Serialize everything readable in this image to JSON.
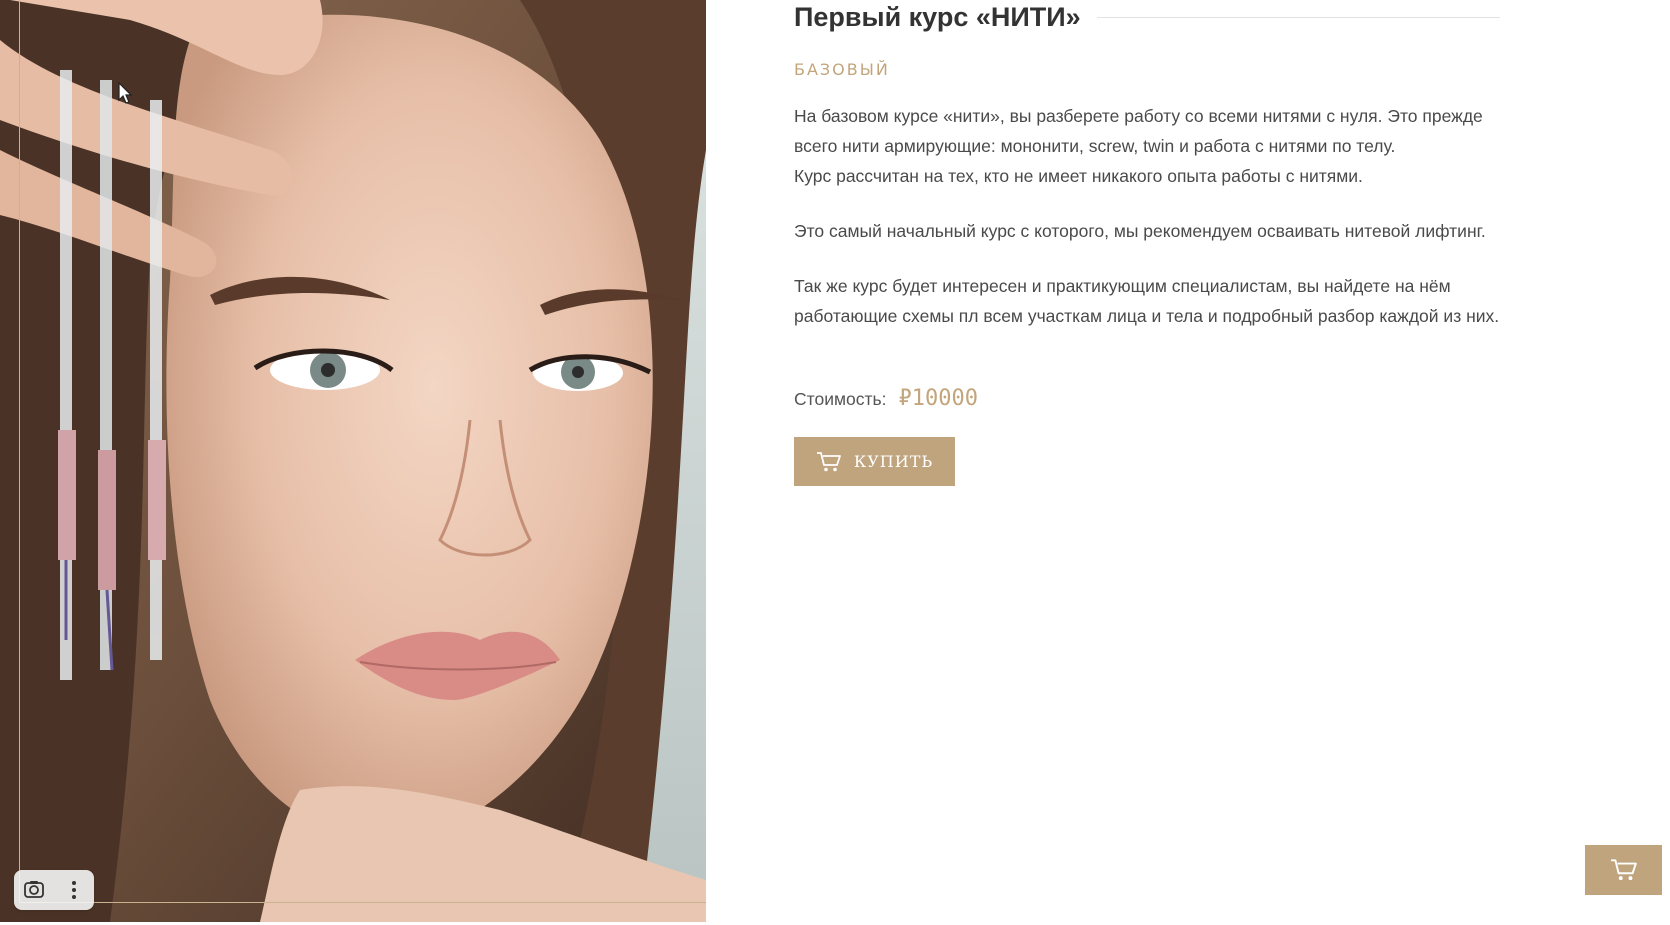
{
  "product": {
    "title": "Первый курс «НИТИ»",
    "level": "БАЗОВЫЙ",
    "description": [
      "На базовом курсе «нити», вы разберете работу со всеми нитями с нуля. Это прежде всего нити армирующие: мононити, screw, twin и работа с нитями по телу.",
      "Курс рассчитан на тех, кто не имеет никакого опыта работы с нитями.",
      "Это самый начальный курс с которого, мы рекомендуем осваивать нитевой лифтинг.",
      "Так же курс будет интересен и практикующим специалистам, вы найдете на нём работающие схемы пл всем участкам лица и тела и подробный разбор каждой из них."
    ],
    "price_label": "Стоимость:",
    "price_value": "₽10000",
    "buy_label": "КУПИТЬ"
  },
  "photo": {
    "tools": {
      "lens_icon": "lens-search-icon",
      "more_icon": "more-vertical-icon"
    }
  },
  "colors": {
    "accent": "#bfa47e",
    "accent_text": "#c3a57c",
    "text": "#4a4a4a"
  },
  "icons": {
    "cart": "cart-icon",
    "cursor": "mouse-cursor-icon"
  }
}
